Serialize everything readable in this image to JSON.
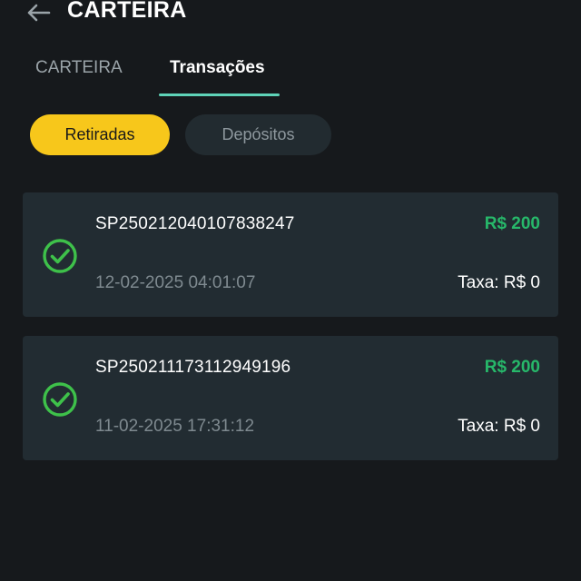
{
  "header": {
    "title": "CARTEIRA",
    "back_icon": "arrow-left-icon"
  },
  "tabs": [
    {
      "label": "CARTEIRA",
      "active": false
    },
    {
      "label": "Transações",
      "active": true
    }
  ],
  "filters": [
    {
      "label": "Retiradas",
      "active": true
    },
    {
      "label": "Depósitos",
      "active": false
    }
  ],
  "transactions": [
    {
      "id": "SP250212040107838247",
      "amount": "R$ 200",
      "datetime": "12-02-2025 04:01:07",
      "fee": "Taxa: R$ 0",
      "status_icon": "check-circle-icon"
    },
    {
      "id": "SP250211173112949196",
      "amount": "R$ 200",
      "datetime": "11-02-2025 17:31:12",
      "fee": "Taxa: R$ 0",
      "status_icon": "check-circle-icon"
    }
  ],
  "colors": {
    "background": "#16191c",
    "card": "#222c32",
    "accent_yellow": "#f7c71b",
    "accent_teal": "#5ed3b8",
    "amount_green": "#27b86a",
    "check_green": "#3ec14a"
  }
}
